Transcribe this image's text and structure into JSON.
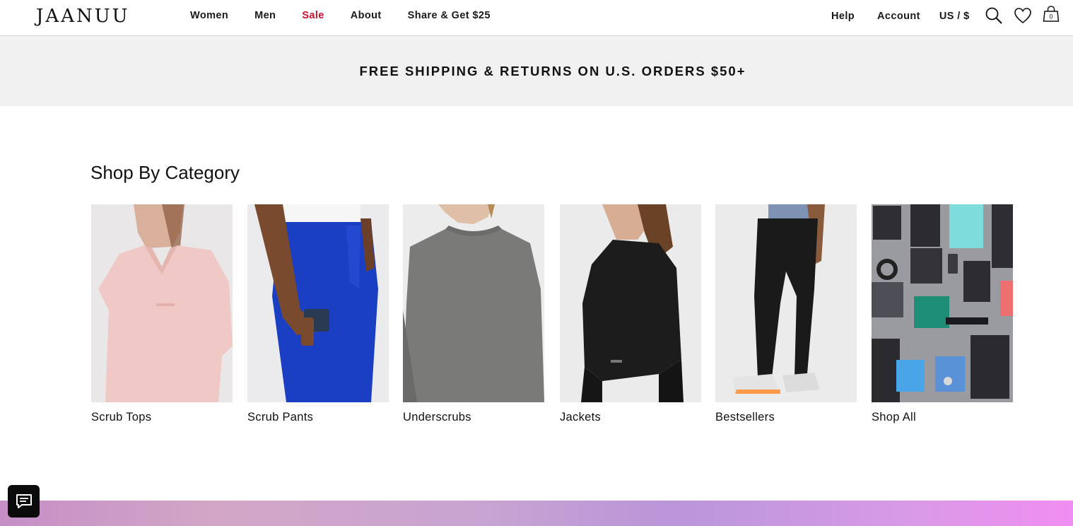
{
  "header": {
    "logo": "JAANUU",
    "nav": [
      {
        "label": "Women",
        "sale": false
      },
      {
        "label": "Men",
        "sale": false
      },
      {
        "label": "Sale",
        "sale": true
      },
      {
        "label": "About",
        "sale": false
      },
      {
        "label": "Share & Get $25",
        "sale": false
      }
    ],
    "right_links": [
      "Help",
      "Account",
      "US / $"
    ],
    "icons": [
      "search-icon",
      "heart-icon",
      "shopping-bag-icon"
    ],
    "cart_count": "0"
  },
  "promo": {
    "text": "FREE SHIPPING & RETURNS ON U.S. ORDERS $50+"
  },
  "category_section": {
    "title": "Shop By Category",
    "categories": [
      {
        "label": "Scrub Tops",
        "image": "woman-pink-scrub-top"
      },
      {
        "label": "Scrub Pants",
        "image": "blue-scrub-pants-with-phone-pocket"
      },
      {
        "label": "Underscrubs",
        "image": "woman-grey-long-sleeve-underscrub"
      },
      {
        "label": "Jackets",
        "image": "woman-black-jacket"
      },
      {
        "label": "Bestsellers",
        "image": "black-jogger-scrub-pants-sneakers"
      },
      {
        "label": "Shop All",
        "image": "flatlay-scrubs-and-accessories"
      }
    ]
  },
  "chat": {
    "icon": "chat-icon"
  },
  "colors": {
    "sale": "#c8102e",
    "promo_bg": "#f1f1f1",
    "text": "#111111"
  }
}
